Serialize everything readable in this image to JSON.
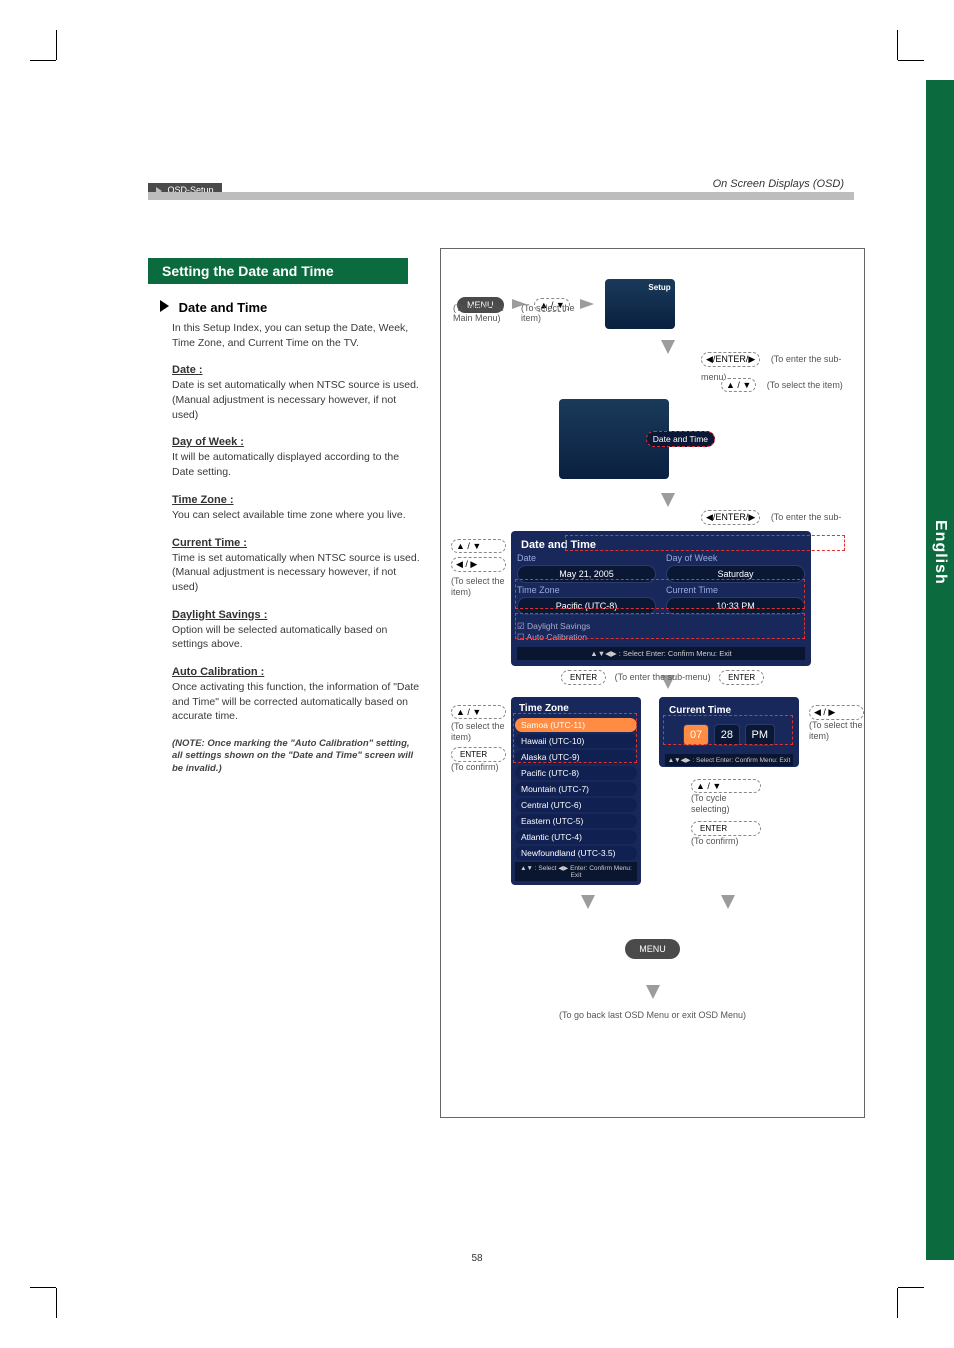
{
  "header": {
    "chip": "OSD-Setup",
    "right": "On Screen Displays (OSD)"
  },
  "title_bar": "Setting the Date and Time",
  "side_tab": "English",
  "left": {
    "section_title": "Date and Time",
    "intro": "In this Setup Index, you can setup the Date, Week, Time Zone, and Current Time on the TV.",
    "date_h": "Date :",
    "date_p": "Date is set automatically when NTSC source is used. (Manual adjustment is necessary however, if not used)",
    "dow_h": "Day of Week :",
    "dow_p": "It will be automatically displayed according to the Date setting.",
    "tz_h": "Time Zone :",
    "tz_p": "You can select available time zone where you live.",
    "ct_h": "Current Time :",
    "ct_p": "Time is set automatically when NTSC source is used. (Manual adjustment is necessary however, if not used)",
    "ds_h": "Daylight Savings :",
    "ds_p": "Option will be selected automatically based on settings above.",
    "ac_h": "Auto Calibration :",
    "ac_p": "Once activating this function, the information of \"Date and Time\" will be corrected automatically based on accurate time.",
    "note": "(NOTE: Once marking the \"Auto Calibration\" setting, all settings shown on the \"Date and Time\" screen will be invalid.)"
  },
  "right": {
    "menu_btn": "MENU",
    "show_main": "(To show the Main Menu)",
    "select_item": "(To select the item)",
    "setup_label": "Setup",
    "enter_sub": "(To enter the sub-menu)",
    "selectthe_item": "(To select the item)",
    "date_time": "Date and Time",
    "osd_dt_title": "Date and Time",
    "osd_date_label": "Date",
    "osd_date_val": "May 21, 2005",
    "osd_dow_label": "Day of Week",
    "osd_dow_val": "Saturday",
    "osd_tz_label": "Time Zone",
    "osd_tz_val": "Pacific (UTC-8)",
    "osd_ct_label": "Current Time",
    "osd_ct_val": "10:33 PM",
    "osd_ds": "Daylight Savings",
    "osd_ac": "Auto Calibration",
    "hint_bar": "▲▼◀▶ : Select    Enter: Confirm    Menu: Exit",
    "enter_sub2": "(To enter the sub-menu)",
    "enter_key": "ENTER",
    "tz_title": "Time Zone",
    "tz_items": [
      "Samoa (UTC-11)",
      "Hawaii (UTC-10)",
      "Alaska (UTC-9)",
      "Pacific (UTC-8)",
      "Mountain (UTC-7)",
      "Central (UTC-6)",
      "Eastern (UTC-5)",
      "Atlantic (UTC-4)",
      "Newfoundland (UTC-3.5)"
    ],
    "tz_hint": "▲▼ : Select    ◀▶ Enter: Confirm    Menu: Exit",
    "left_note": "(To select the item)",
    "ct_title": "Current Time",
    "ct_h": "07",
    "ct_m": "28",
    "ct_ampm": "PM",
    "ct_hint": "▲▼◀▶ : Select    Enter: Confirm    Menu: Exit",
    "cycle": "(To cycle selecting)",
    "confirm": "(To confirm)",
    "back_note": "(To go back last OSD Menu or exit OSD Menu)",
    "key_ud": "▲ / ▼",
    "key_lr": "◀ / ▶",
    "key_enter_combo": "◀/ENTER/▶"
  },
  "page_number": "58"
}
